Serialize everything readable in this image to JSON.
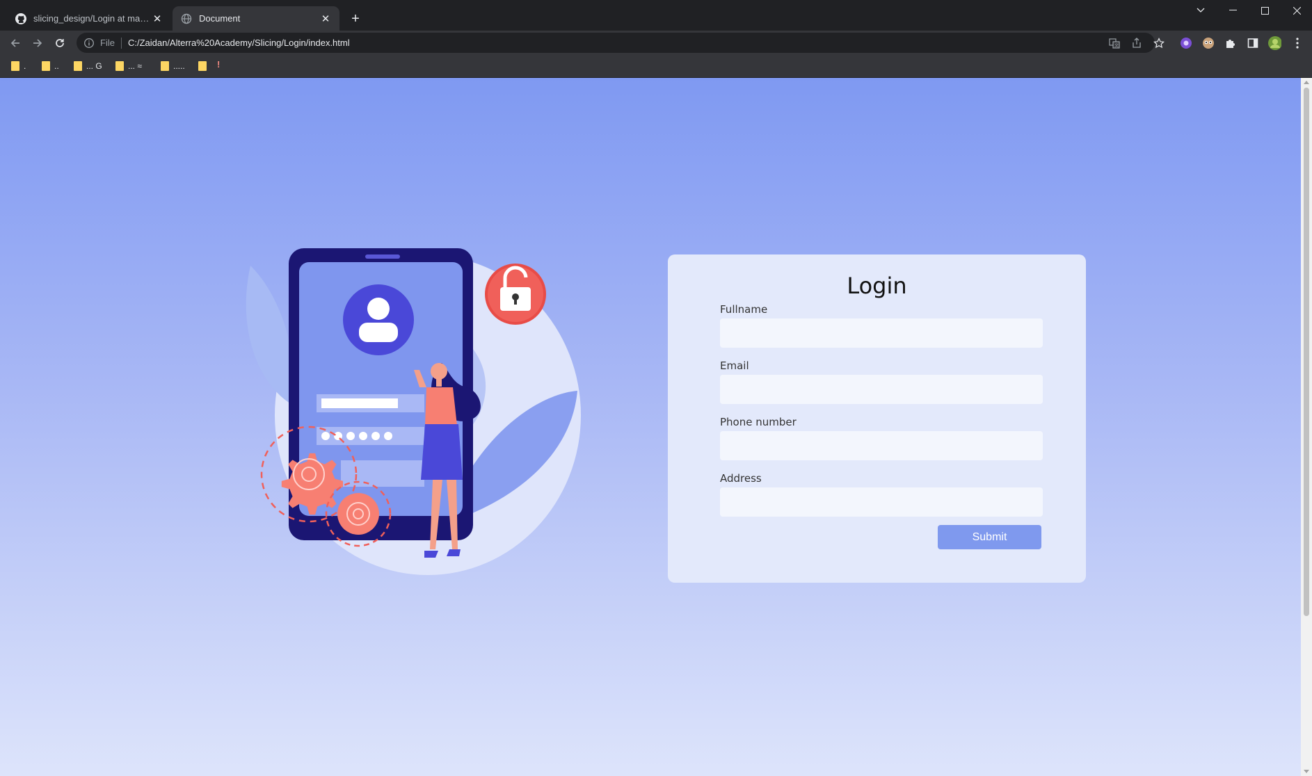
{
  "browser": {
    "tabs": [
      {
        "title": "slicing_design/Login at master · ...",
        "favicon": "github-icon",
        "active": false
      },
      {
        "title": "Document",
        "favicon": "globe-icon",
        "active": true
      }
    ],
    "address_bar": {
      "scheme_label": "File",
      "url": "C:/Zaidan/Alterra%20Academy/Slicing/Login/index.html"
    },
    "bookmarks": [
      ".",
      "..",
      "... G",
      "... ≈",
      "....."
    ],
    "bookmark_warning": "!"
  },
  "page": {
    "illustration": "login-security-illustration",
    "form": {
      "title": "Login",
      "fields": [
        {
          "label": "Fullname",
          "value": ""
        },
        {
          "label": "Email",
          "value": ""
        },
        {
          "label": "Phone number",
          "value": ""
        },
        {
          "label": "Address",
          "value": ""
        }
      ],
      "submit_label": "Submit"
    }
  },
  "colors": {
    "accent": "#7f99ee",
    "card": "#e3e9fb",
    "lock": "#f0605a",
    "device": "#1b1673"
  }
}
